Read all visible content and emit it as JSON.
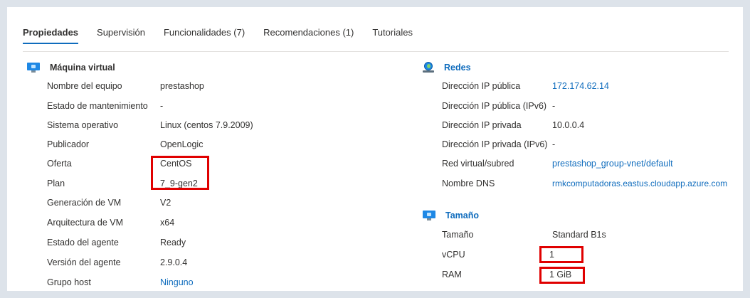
{
  "tabs": [
    {
      "label": "Propiedades",
      "active": true
    },
    {
      "label": "Supervisión",
      "active": false
    },
    {
      "label": "Funcionalidades (7)",
      "active": false
    },
    {
      "label": "Recomendaciones (1)",
      "active": false
    },
    {
      "label": "Tutoriales",
      "active": false
    }
  ],
  "vm": {
    "title": "Máquina virtual",
    "icon": "monitor-icon",
    "rows": [
      {
        "label": "Nombre del equipo",
        "value": "prestashop"
      },
      {
        "label": "Estado de mantenimiento",
        "value": "-"
      },
      {
        "label": "Sistema operativo",
        "value": "Linux (centos 7.9.2009)"
      },
      {
        "label": "Publicador",
        "value": "OpenLogic"
      },
      {
        "label": "Oferta",
        "value": "CentOS"
      },
      {
        "label": "Plan",
        "value": "7_9-gen2"
      },
      {
        "label": "Generación de VM",
        "value": "V2"
      },
      {
        "label": "Arquitectura de VM",
        "value": "x64"
      },
      {
        "label": "Estado del agente",
        "value": "Ready"
      },
      {
        "label": "Versión del agente",
        "value": "2.9.0.4"
      },
      {
        "label": "Grupo host",
        "value": "Ninguno"
      }
    ]
  },
  "network": {
    "title": "Redes",
    "icon": "network-icon",
    "rows": [
      {
        "label": "Dirección IP pública",
        "value": "172.174.62.14"
      },
      {
        "label": "Dirección IP pública (IPv6)",
        "value": "-"
      },
      {
        "label": "Dirección IP privada",
        "value": "10.0.0.4"
      },
      {
        "label": "Dirección IP privada (IPv6)",
        "value": "-"
      },
      {
        "label": "Red virtual/subred",
        "value": "prestashop_group-vnet/default"
      },
      {
        "label": "Nombre DNS",
        "value": "rmkcomputadoras.eastus.cloudapp.azure.com"
      }
    ]
  },
  "size": {
    "title": "Tamaño",
    "icon": "monitor-icon",
    "rows": [
      {
        "label": "Tamaño",
        "value": "Standard B1s"
      },
      {
        "label": "vCPU",
        "value": "1"
      },
      {
        "label": "RAM",
        "value": "1 GiB"
      }
    ]
  },
  "colors": {
    "link": "#0f6cbd",
    "highlight": "#e00000",
    "tab_underline": "#0f6cbd"
  }
}
